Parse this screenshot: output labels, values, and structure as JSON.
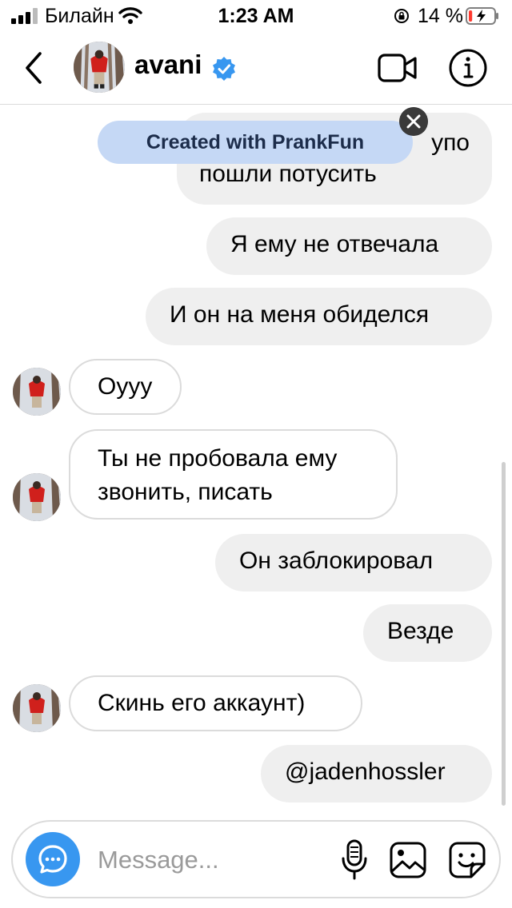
{
  "status_bar": {
    "carrier": "Билайн",
    "time": "1:23 AM",
    "battery_percent": "14 %",
    "battery_level": 0.14,
    "icons": [
      "signal-icon",
      "wifi-icon",
      "orientation-lock-icon",
      "battery-charging-icon"
    ]
  },
  "header": {
    "username": "avani",
    "verified": true,
    "icons": [
      "back-chevron-icon",
      "video-call-icon",
      "info-icon"
    ]
  },
  "banner": {
    "text": "Created with PrankFun"
  },
  "messages": [
    {
      "sender": "me",
      "partial_top": "упо",
      "text": "пошли потусить"
    },
    {
      "sender": "me",
      "text": "Я ему не отвечала"
    },
    {
      "sender": "me",
      "text": "И он на меня обиделся"
    },
    {
      "sender": "avani",
      "text": "Оууу"
    },
    {
      "sender": "avani",
      "lines": [
        "Ты не пробовала ему",
        "звонить, писать"
      ]
    },
    {
      "sender": "me",
      "text": "Он заблокировал"
    },
    {
      "sender": "me",
      "text": "Везде"
    },
    {
      "sender": "avani",
      "text": "Скинь его аккаунт)"
    },
    {
      "sender": "me",
      "text": "@jadenhossler"
    }
  ],
  "composer": {
    "value": "",
    "placeholder": "Message...",
    "icons": [
      "camera-chat-icon",
      "microphone-icon",
      "gallery-icon",
      "sticker-icon"
    ]
  },
  "colors": {
    "outgoing_bubble": "#efefef",
    "incoming_border": "#dbdbdb",
    "verified_badge": "#3897f0",
    "camera_button": "#3897f0",
    "banner_bg": "#c5d8f5",
    "battery_low": "#ff3b30"
  }
}
